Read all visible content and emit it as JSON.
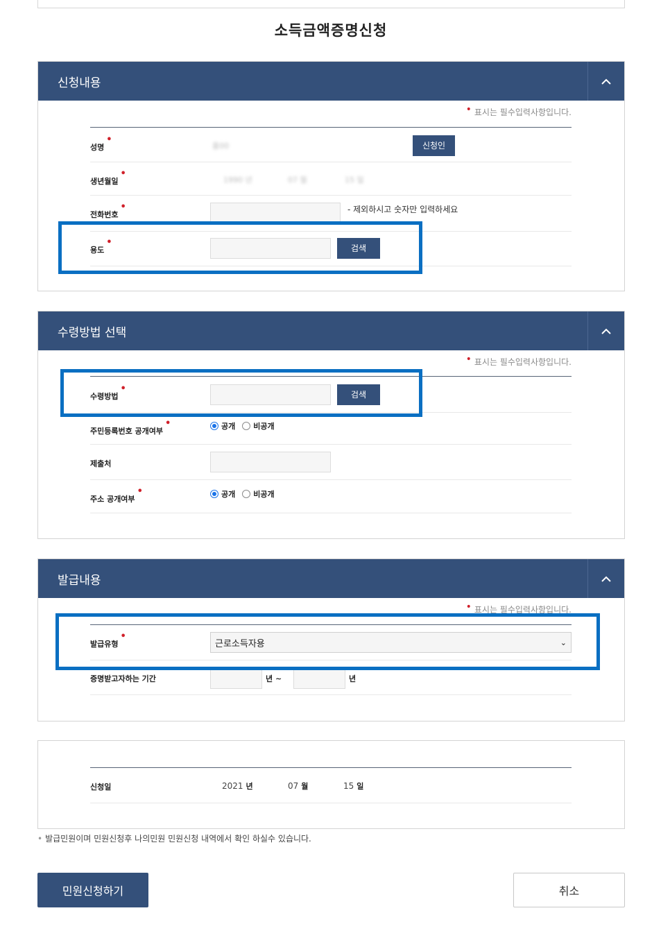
{
  "page_title": "소득금액증명신청",
  "required_note": "표시는 필수입력사항입니다.",
  "sections": {
    "application": {
      "title": "신청내용",
      "name_label": "성명",
      "name_value": "홍00",
      "applicant_button": "신청인",
      "birth_label": "생년월일",
      "birth_year": "1990 년",
      "birth_month": "07 월",
      "birth_day": "15 일",
      "phone_label": "전화번호",
      "phone_value": "",
      "phone_hint": "- 제외하시고 숫자만 입력하세요",
      "purpose_label": "용도",
      "purpose_value": "",
      "search_button": "검색"
    },
    "receipt": {
      "title": "수령방법 선택",
      "method_label": "수령방법",
      "method_value": "",
      "search_button": "검색",
      "rrn_label": "주민등록번호 공개여부",
      "rrn_public": "공개",
      "rrn_private": "비공개",
      "submit_to_label": "제출처",
      "submit_to_value": "",
      "address_label": "주소 공개여부",
      "address_public": "공개",
      "address_private": "비공개"
    },
    "issuance": {
      "title": "발급내용",
      "type_label": "발급유형",
      "type_selected": "근로소득자용",
      "period_label": "증명받고자하는 기간",
      "period_from_value": "",
      "period_from_unit": "년 ~",
      "period_to_value": "",
      "period_to_unit": "년"
    },
    "date": {
      "label": "신청일",
      "year": "2021",
      "year_unit": "년",
      "month": "07",
      "month_unit": "월",
      "day": "15",
      "day_unit": "일"
    }
  },
  "footnote": "발급민원이며 민원신청후 나의민원 민원신청 내역에서 확인 하실수 있습니다.",
  "buttons": {
    "submit": "민원신청하기",
    "cancel": "취소"
  },
  "colors": {
    "header_bg": "#34507a",
    "highlight": "#0a6fc2",
    "required_dot": "#d0202a"
  },
  "icons": {
    "collapse": "chevron-up-icon"
  }
}
